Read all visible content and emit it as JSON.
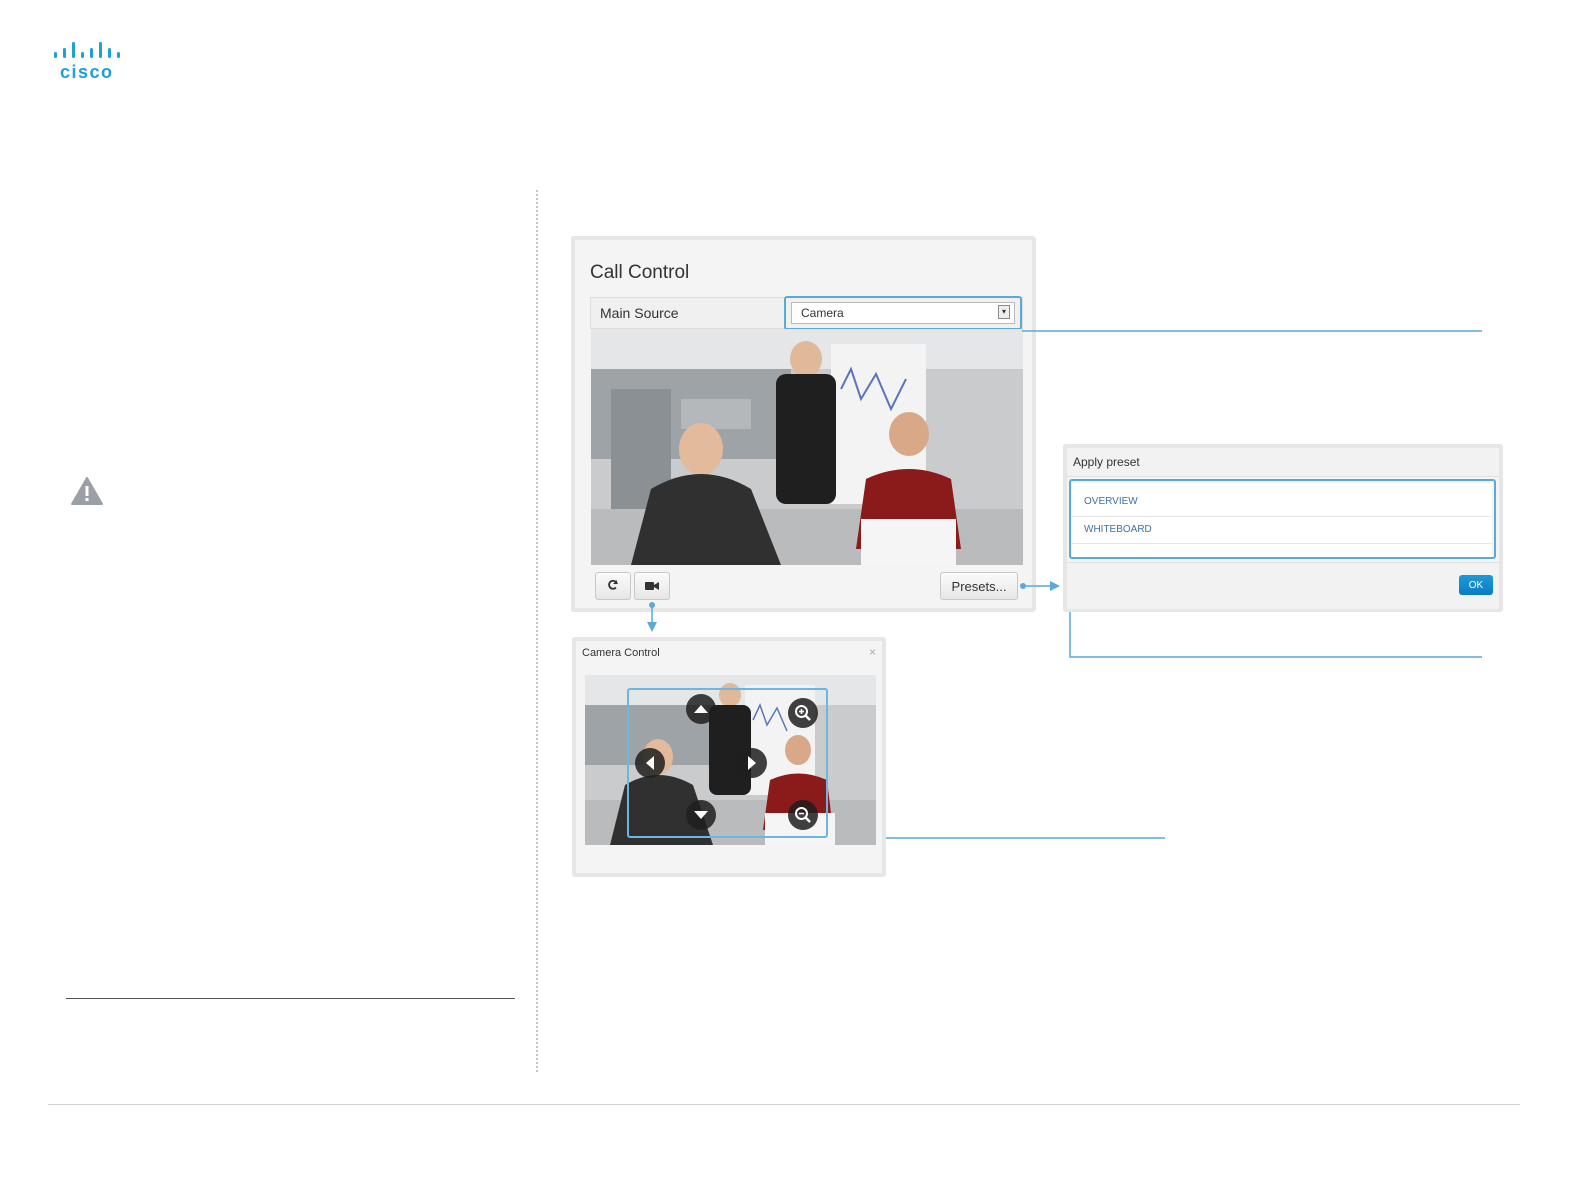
{
  "logo": {
    "text": "cisco"
  },
  "call_control": {
    "title": "Call Control",
    "main_source_label": "Main Source",
    "source_select_value": "Camera",
    "presets_button": "Presets..."
  },
  "camera_control": {
    "title": "Camera Control",
    "close": "×"
  },
  "apply_preset": {
    "title": "Apply preset",
    "items": [
      "OVERVIEW",
      "WHITEBOARD"
    ],
    "ok_button": "OK"
  },
  "colors": {
    "accent": "#5aa9d6",
    "ok_button": "#0a7cc0",
    "logo": "#1ba0d7"
  },
  "icons": [
    "warning-icon",
    "refresh-icon",
    "camera-icon",
    "zoom-in-icon",
    "zoom-out-icon",
    "arrow-up-icon",
    "arrow-down-icon",
    "arrow-left-icon",
    "arrow-right-icon"
  ]
}
